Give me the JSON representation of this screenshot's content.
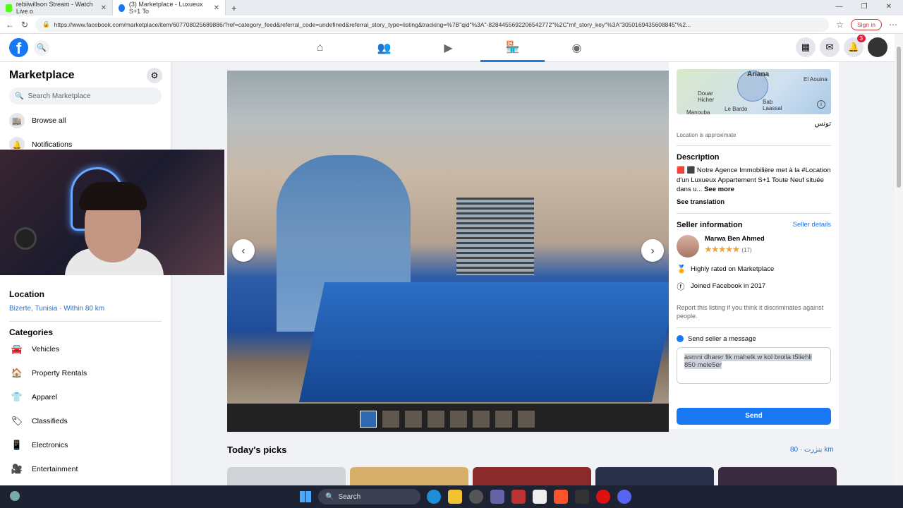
{
  "browser": {
    "tabs": [
      {
        "title": "rebiiwillson Stream - Watch Live o",
        "color": "#53fc18"
      },
      {
        "title": "(3) Marketplace - Luxueux S+1 To",
        "color": "#1877f2"
      }
    ],
    "url": "https://www.facebook.com/marketplace/item/607708025689886/?ref=category_feed&referral_code=undefined&referral_story_type=listing&tracking=%7B\"qid\"%3A\"-8284455692206542772\"%2C\"mf_story_key\"%3A\"3050169435608845\"%2...",
    "sign_in": "Sign in"
  },
  "fb": {
    "logo": "f",
    "notif_count": "3"
  },
  "sidebar": {
    "title": "Marketplace",
    "search_placeholder": "Search Marketplace",
    "items": [
      {
        "label": "Browse all",
        "icon": "store-icon"
      },
      {
        "label": "Notifications",
        "icon": "bell-icon"
      }
    ],
    "location_heading": "Location",
    "location_value": "Bizerte, Tunisia · Within 80 km",
    "categories_heading": "Categories",
    "categories": [
      {
        "label": "Vehicles",
        "icon": "car-icon",
        "glyph": "🚘"
      },
      {
        "label": "Property Rentals",
        "icon": "house-icon",
        "glyph": "🏠"
      },
      {
        "label": "Apparel",
        "icon": "shirt-icon",
        "glyph": "👕"
      },
      {
        "label": "Classifieds",
        "icon": "tag-icon",
        "glyph": "🏷"
      },
      {
        "label": "Electronics",
        "icon": "phone-icon",
        "glyph": "📱"
      },
      {
        "label": "Entertainment",
        "icon": "film-icon",
        "glyph": "🎥"
      }
    ]
  },
  "listing": {
    "map_label_ariana": "Ariana",
    "map_label_elaouina": "El Aouina",
    "map_label_douar": "Douar Hicher",
    "map_label_bab": "Bab Laassal",
    "map_label_lebardo": "Le Bardo",
    "map_label_manouba": "Manouba",
    "city": "تونس",
    "approx": "Location is approximate",
    "description_heading": "Description",
    "description": "🟥 ⬛ Notre Agence Immobilière met à la #Location d'un Luxueux Appartement S+1 Toute Neuf située dans u...",
    "see_more": "See more",
    "see_translation": "See translation",
    "seller_heading": "Seller information",
    "seller_details": "Seller details",
    "seller_name": "Marwa Ben Ahmed",
    "seller_stars": "★★★★★",
    "seller_reviews": "(17)",
    "fact1": "Highly rated on Marketplace",
    "fact2": "Joined Facebook in 2017",
    "report": "Report this listing if you think it discriminates against people.",
    "message_heading": "Send seller a message",
    "message_text": "asmni dharer fik mahelk w kol broila t5liehli 850 mele5er",
    "send": "Send"
  },
  "picks": {
    "title": "Today's picks",
    "location": "بنزرت · 80 km"
  },
  "taskbar": {
    "search": "Search"
  }
}
